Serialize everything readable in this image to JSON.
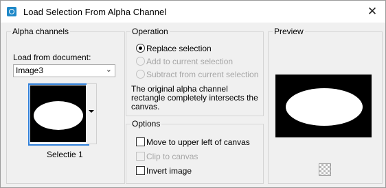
{
  "window": {
    "title": "Load Selection From Alpha Channel",
    "close_glyph": "✕"
  },
  "alpha_channels": {
    "group_label": "Alpha channels",
    "load_from_label": "Load from document:",
    "document_selected": "Image3",
    "channel_name": "Selectie 1"
  },
  "operation": {
    "group_label": "Operation",
    "options": [
      {
        "label": "Replace selection",
        "checked": true,
        "enabled": true
      },
      {
        "label": "Add to current selection",
        "checked": false,
        "enabled": false
      },
      {
        "label": "Subtract from current selection",
        "checked": false,
        "enabled": false
      }
    ],
    "message_line1": "The original alpha channel",
    "message_line2": "rectangle completely intersects the",
    "message_line3": "canvas."
  },
  "options": {
    "group_label": "Options",
    "items": [
      {
        "label": "Move to upper left of canvas",
        "checked": false,
        "enabled": true
      },
      {
        "label": "Clip to canvas",
        "checked": false,
        "enabled": false
      },
      {
        "label": "Invert image",
        "checked": false,
        "enabled": true
      }
    ]
  },
  "preview": {
    "group_label": "Preview"
  },
  "colors": {
    "thumbnail_selection_border": "#2f7fd9",
    "app_icon": "#1e88c8"
  }
}
